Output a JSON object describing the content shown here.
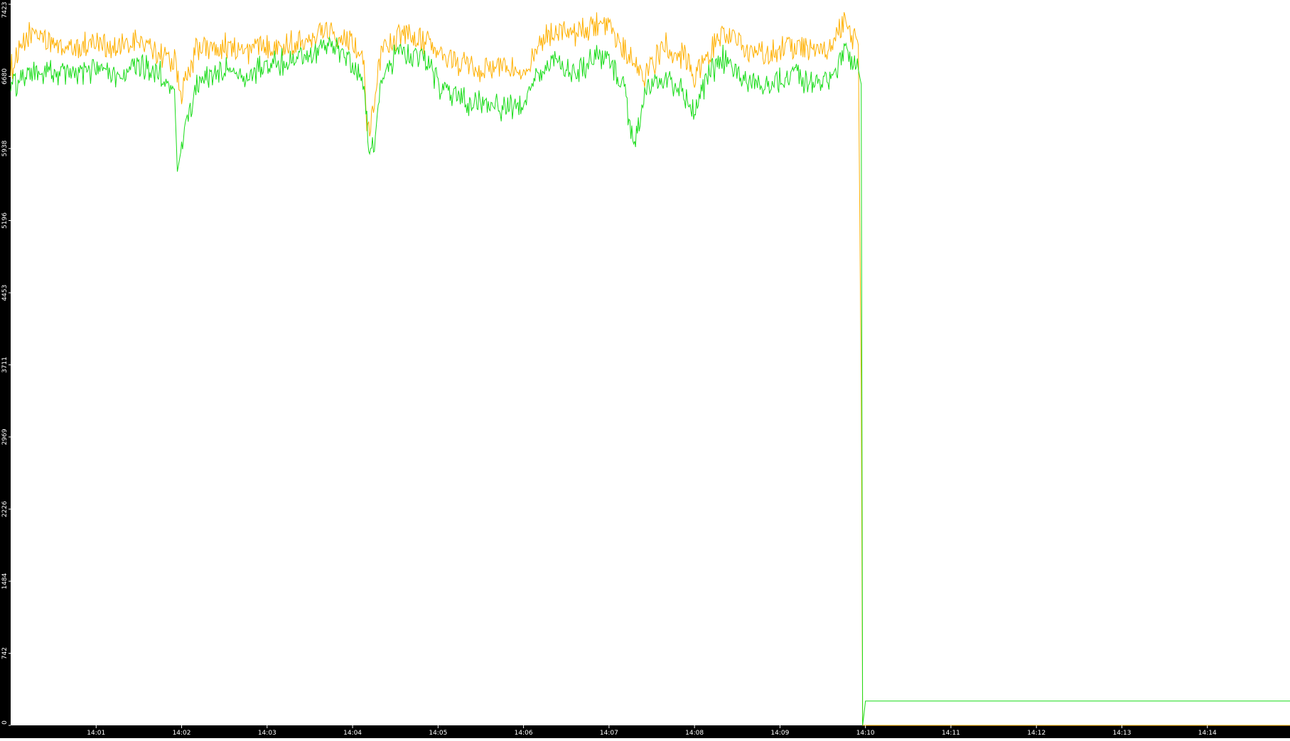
{
  "chart_data": {
    "type": "line",
    "title": "",
    "xlabel": "",
    "ylabel": "",
    "ylim": [
      0,
      7423
    ],
    "xlim": [
      "14:00:00",
      "14:14:58"
    ],
    "grid": false,
    "legend": "none",
    "x_ticks": [
      "14:01",
      "14:02",
      "14:03",
      "14:04",
      "14:05",
      "14:06",
      "14:07",
      "14:08",
      "14:09",
      "14:10",
      "14:11",
      "14:12",
      "14:13",
      "14:14"
    ],
    "y_ticks": [
      0,
      742,
      1484,
      2226,
      2969,
      3711,
      4453,
      5196,
      5938,
      6680,
      7423
    ],
    "series": [
      {
        "color": "#ffb000",
        "points": [
          [
            "14:00:00",
            6760
          ],
          [
            "14:00:15",
            7150
          ],
          [
            "14:00:30",
            7000
          ],
          [
            "14:00:45",
            6960
          ],
          [
            "14:01:00",
            7050
          ],
          [
            "14:01:15",
            6950
          ],
          [
            "14:01:30",
            7050
          ],
          [
            "14:01:45",
            6900
          ],
          [
            "14:01:55",
            6850
          ],
          [
            "14:02:00",
            6500
          ],
          [
            "14:02:10",
            6950
          ],
          [
            "14:02:30",
            7000
          ],
          [
            "14:02:45",
            6930
          ],
          [
            "14:03:00",
            7020
          ],
          [
            "14:03:15",
            7000
          ],
          [
            "14:03:30",
            7100
          ],
          [
            "14:03:45",
            7150
          ],
          [
            "14:04:00",
            7050
          ],
          [
            "14:04:08",
            6850
          ],
          [
            "14:04:10",
            6100
          ],
          [
            "14:04:14",
            6300
          ],
          [
            "14:04:20",
            6950
          ],
          [
            "14:04:35",
            7100
          ],
          [
            "14:04:50",
            7050
          ],
          [
            "14:05:00",
            6900
          ],
          [
            "14:05:15",
            6820
          ],
          [
            "14:05:30",
            6750
          ],
          [
            "14:05:45",
            6780
          ],
          [
            "14:06:00",
            6760
          ],
          [
            "14:06:10",
            6950
          ],
          [
            "14:06:20",
            7150
          ],
          [
            "14:06:35",
            7100
          ],
          [
            "14:06:50",
            7200
          ],
          [
            "14:07:00",
            7150
          ],
          [
            "14:07:10",
            6950
          ],
          [
            "14:07:25",
            6700
          ],
          [
            "14:07:40",
            7000
          ],
          [
            "14:07:55",
            6850
          ],
          [
            "14:08:00",
            6700
          ],
          [
            "14:08:10",
            6900
          ],
          [
            "14:08:20",
            7150
          ],
          [
            "14:08:35",
            6950
          ],
          [
            "14:08:50",
            6900
          ],
          [
            "14:09:05",
            7000
          ],
          [
            "14:09:20",
            6950
          ],
          [
            "14:09:35",
            6950
          ],
          [
            "14:09:45",
            7250
          ],
          [
            "14:09:55",
            7000
          ],
          [
            "14:09:57",
            3540
          ],
          [
            "14:09:58",
            0
          ],
          [
            "14:14:58",
            0
          ]
        ]
      },
      {
        "color": "#19dc19",
        "points": [
          [
            "14:00:00",
            6600
          ],
          [
            "14:00:15",
            6700
          ],
          [
            "14:00:30",
            6720
          ],
          [
            "14:00:45",
            6700
          ],
          [
            "14:01:00",
            6730
          ],
          [
            "14:01:15",
            6680
          ],
          [
            "14:01:30",
            6800
          ],
          [
            "14:01:45",
            6700
          ],
          [
            "14:01:55",
            6550
          ],
          [
            "14:01:57",
            5700
          ],
          [
            "14:02:00",
            5950
          ],
          [
            "14:02:10",
            6600
          ],
          [
            "14:02:30",
            6750
          ],
          [
            "14:02:45",
            6650
          ],
          [
            "14:03:00",
            6800
          ],
          [
            "14:03:15",
            6850
          ],
          [
            "14:03:30",
            6900
          ],
          [
            "14:03:45",
            7000
          ],
          [
            "14:04:00",
            6800
          ],
          [
            "14:04:08",
            6600
          ],
          [
            "14:04:12",
            5850
          ],
          [
            "14:04:16",
            6100
          ],
          [
            "14:04:20",
            6700
          ],
          [
            "14:04:35",
            6950
          ],
          [
            "14:04:50",
            6850
          ],
          [
            "14:05:00",
            6600
          ],
          [
            "14:05:15",
            6450
          ],
          [
            "14:05:30",
            6400
          ],
          [
            "14:05:45",
            6350
          ],
          [
            "14:06:00",
            6400
          ],
          [
            "14:06:10",
            6700
          ],
          [
            "14:06:20",
            6850
          ],
          [
            "14:06:35",
            6700
          ],
          [
            "14:06:50",
            6900
          ],
          [
            "14:07:00",
            6850
          ],
          [
            "14:07:10",
            6600
          ],
          [
            "14:07:18",
            5950
          ],
          [
            "14:07:25",
            6500
          ],
          [
            "14:07:40",
            6700
          ],
          [
            "14:07:55",
            6450
          ],
          [
            "14:08:00",
            6350
          ],
          [
            "14:08:10",
            6700
          ],
          [
            "14:08:20",
            6850
          ],
          [
            "14:08:35",
            6650
          ],
          [
            "14:08:50",
            6600
          ],
          [
            "14:09:05",
            6700
          ],
          [
            "14:09:20",
            6600
          ],
          [
            "14:09:35",
            6650
          ],
          [
            "14:09:45",
            6950
          ],
          [
            "14:09:55",
            6750
          ],
          [
            "14:09:57",
            6600
          ],
          [
            "14:09:58",
            0
          ],
          [
            "14:09:59",
            120
          ],
          [
            "14:10:00",
            250
          ],
          [
            "14:14:58",
            250
          ]
        ]
      }
    ]
  }
}
